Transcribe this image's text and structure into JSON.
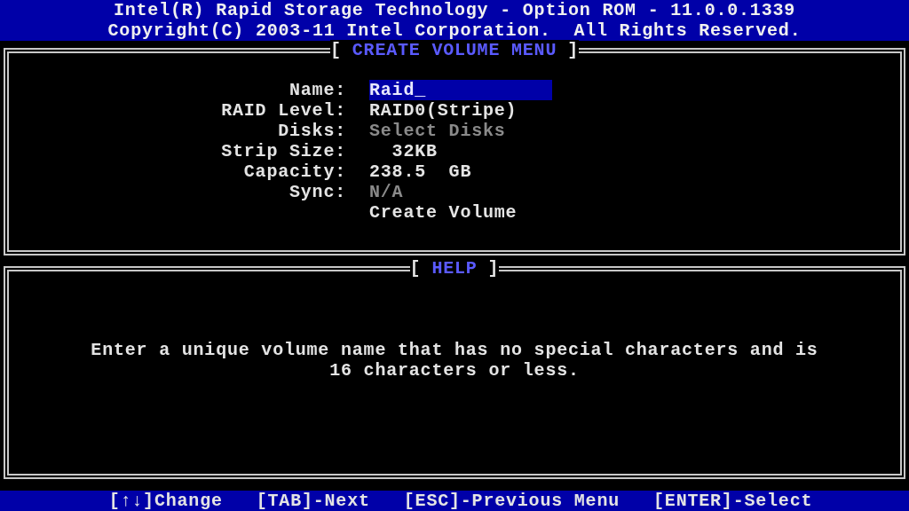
{
  "header": {
    "lines": [
      "Intel(R) Rapid Storage Technology - Option ROM - 11.0.0.1339",
      "Copyright(C) 2003-11 Intel Corporation.  All Rights Reserved."
    ]
  },
  "menu": {
    "bracket_left": "[",
    "title": "CREATE VOLUME MENU",
    "bracket_right": "]",
    "fields": [
      {
        "kind": "field",
        "label": "Name:",
        "value": "Raid_",
        "selected": true,
        "disabled": false
      },
      {
        "kind": "field",
        "label": "RAID Level:",
        "value": "RAID0(Stripe)",
        "selected": false,
        "disabled": false
      },
      {
        "kind": "field",
        "label": "Disks:",
        "value": "Select Disks",
        "selected": false,
        "disabled": true
      },
      {
        "kind": "field",
        "label": "Strip Size:",
        "value": "  32KB",
        "selected": false,
        "disabled": false
      },
      {
        "kind": "field",
        "label": "Capacity:",
        "value": "238.5  GB",
        "selected": false,
        "disabled": false
      },
      {
        "kind": "field",
        "label": "Sync:",
        "value": "N/A",
        "selected": false,
        "disabled": true
      },
      {
        "kind": "action",
        "value": "Create Volume",
        "selected": false,
        "disabled": false
      }
    ]
  },
  "help": {
    "bracket_left": "[",
    "title": "HELP",
    "bracket_right": "]",
    "lines": [
      "Enter a unique volume name that has no special characters and is",
      "16 characters or less."
    ]
  },
  "footer": {
    "hints": [
      "[↑↓]Change",
      "[TAB]-Next",
      "[ESC]-Previous Menu",
      "[ENTER]-Select"
    ]
  }
}
